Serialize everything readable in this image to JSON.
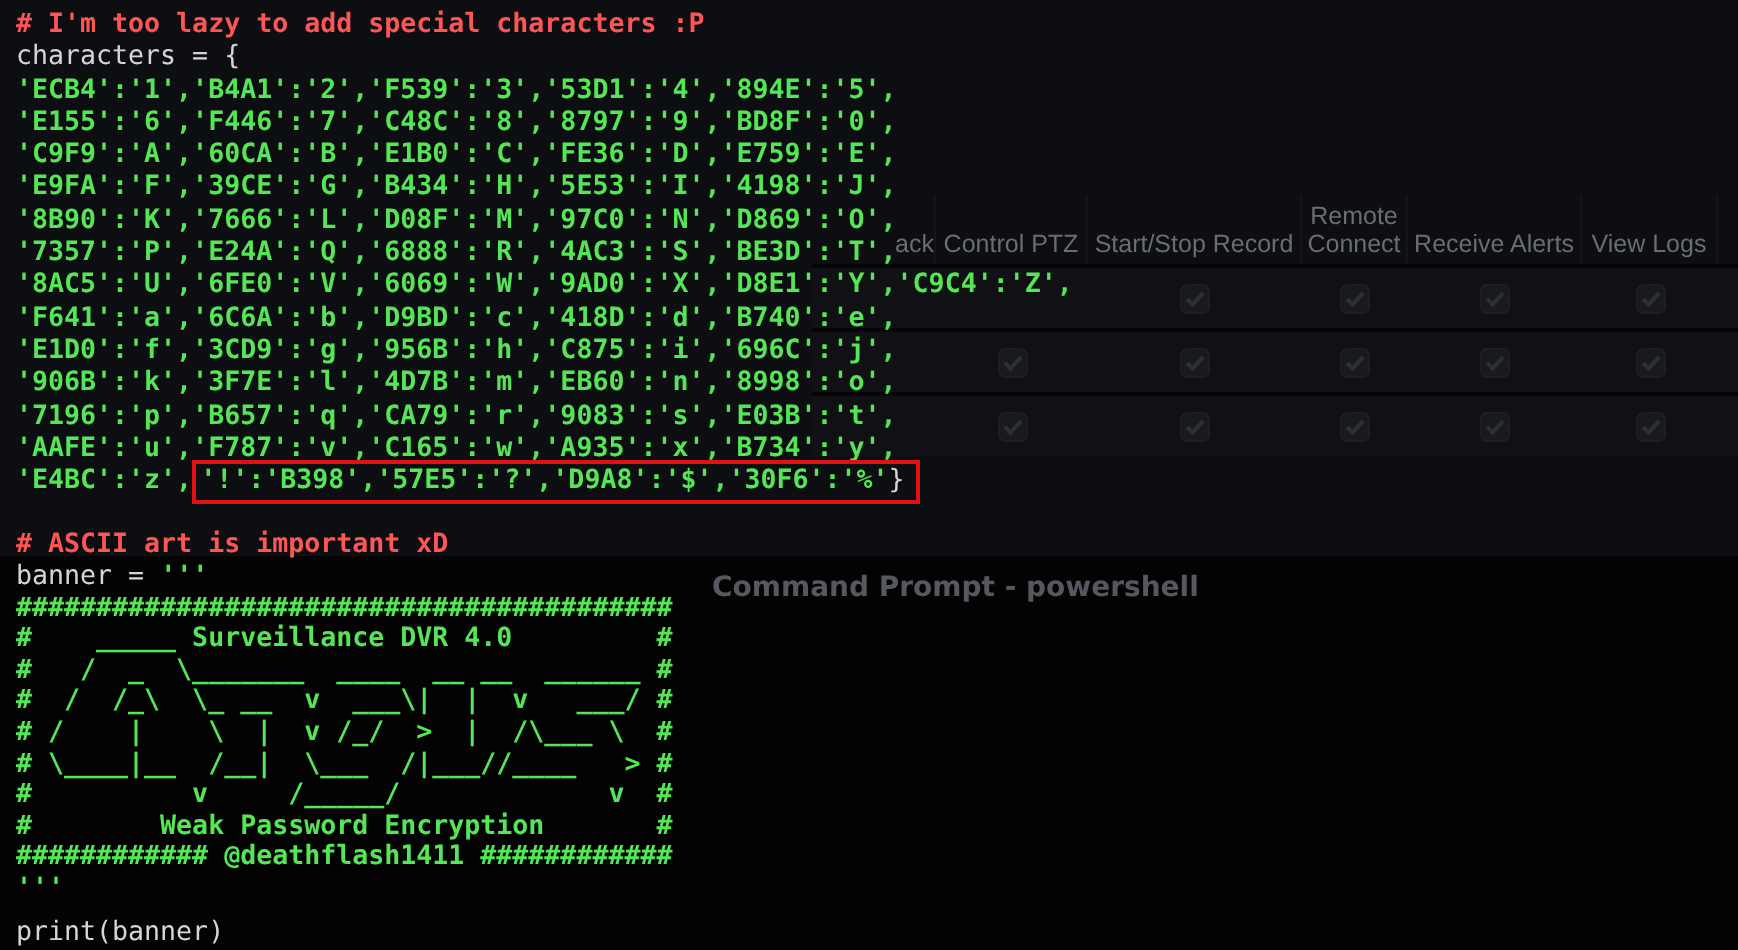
{
  "code_top": [
    {
      "segments": [
        {
          "kind": "comment",
          "text": "# I'm too lazy to add special characters :P",
          "boxed": false
        }
      ]
    },
    {
      "segments": [
        {
          "kind": "plain",
          "text": "characters = {",
          "boxed": false
        }
      ]
    },
    {
      "segments": [
        {
          "kind": "string",
          "text": "'ECB4':'1','B4A1':'2','F539':'3','53D1':'4','894E':'5',",
          "boxed": false
        }
      ]
    },
    {
      "segments": [
        {
          "kind": "string",
          "text": "'E155':'6','F446':'7','C48C':'8','8797':'9','BD8F':'0',",
          "boxed": false
        }
      ]
    },
    {
      "segments": [
        {
          "kind": "string",
          "text": "'C9F9':'A','60CA':'B','E1B0':'C','FE36':'D','E759':'E',",
          "boxed": false
        }
      ]
    },
    {
      "segments": [
        {
          "kind": "string",
          "text": "'E9FA':'F','39CE':'G','B434':'H','5E53':'I','4198':'J',",
          "boxed": false
        }
      ]
    },
    {
      "segments": [
        {
          "kind": "string",
          "text": "'8B90':'K','7666':'L','D08F':'M','97C0':'N','D869':'O',",
          "boxed": false
        }
      ]
    },
    {
      "segments": [
        {
          "kind": "string",
          "text": "'7357':'P','E24A':'Q','6888':'R','4AC3':'S','BE3D':'T',",
          "boxed": false
        }
      ]
    },
    {
      "segments": [
        {
          "kind": "string",
          "text": "'8AC5':'U','6FE0':'V','6069':'W','9AD0':'X','D8E1':'Y','C9C4':'Z',",
          "boxed": false
        }
      ]
    },
    {
      "segments": [
        {
          "kind": "string",
          "text": "'F641':'a','6C6A':'b','D9BD':'c','418D':'d','B740':'e',",
          "boxed": false
        }
      ]
    },
    {
      "segments": [
        {
          "kind": "string",
          "text": "'E1D0':'f','3CD9':'g','956B':'h','C875':'i','696C':'j',",
          "boxed": false
        }
      ]
    },
    {
      "segments": [
        {
          "kind": "string",
          "text": "'906B':'k','3F7E':'l','4D7B':'m','EB60':'n','8998':'o',",
          "boxed": false
        }
      ]
    },
    {
      "segments": [
        {
          "kind": "string",
          "text": "'7196':'p','B657':'q','CA79':'r','9083':'s','E03B':'t',",
          "boxed": false
        }
      ]
    },
    {
      "segments": [
        {
          "kind": "string",
          "text": "'AAFE':'u','F787':'v','C165':'w','A935':'x','B734':'y',",
          "boxed": false
        }
      ]
    },
    {
      "segments": [
        {
          "kind": "string",
          "text": "'E4BC':'z',",
          "boxed": false
        },
        {
          "kind": "string",
          "text": "'!':'B398','57E5':'?','D9A8':'$','30F6':'%'",
          "boxed": true
        },
        {
          "kind": "plain",
          "text": "}",
          "boxed": true
        }
      ]
    }
  ],
  "code_bottom": [
    {
      "segments": [
        {
          "kind": "comment",
          "text": "# ASCII art is important xD"
        }
      ]
    },
    {
      "segments": [
        {
          "kind": "plain",
          "text": "banner = "
        },
        {
          "kind": "string",
          "text": "'''"
        }
      ]
    },
    {
      "segments": [
        {
          "kind": "art",
          "text": "#########################################"
        }
      ]
    },
    {
      "segments": [
        {
          "kind": "art",
          "text": "#    _____ Surveillance DVR 4.0         #"
        }
      ]
    },
    {
      "segments": [
        {
          "kind": "art",
          "text": "#   /  _  \\_______  ____  __ __  ______ #"
        }
      ]
    },
    {
      "segments": [
        {
          "kind": "art",
          "text": "#  /  /_\\  \\_ __  v  ___\\|  |  v   ___/ #"
        }
      ]
    },
    {
      "segments": [
        {
          "kind": "art",
          "text": "# /    |    \\  |  v /_/  >  |  /\\___ \\  #"
        }
      ]
    },
    {
      "segments": [
        {
          "kind": "art",
          "text": "# \\____|__  /__|  \\___  /|___//____   > #"
        }
      ]
    },
    {
      "segments": [
        {
          "kind": "art",
          "text": "#          v     /_____/             v  #"
        }
      ]
    },
    {
      "segments": [
        {
          "kind": "art",
          "text": "#        Weak Password Encryption       #"
        }
      ]
    },
    {
      "segments": [
        {
          "kind": "art",
          "text": "############ @deathflash1411 ############"
        }
      ]
    },
    {
      "segments": [
        {
          "kind": "string",
          "text": "'''"
        }
      ]
    }
  ],
  "code_last": [
    {
      "segments": [
        {
          "kind": "plain",
          "text": "print(banner)"
        }
      ]
    }
  ],
  "table": {
    "columns": [
      "ack",
      "Control  PTZ",
      "Start/Stop Record",
      "Remote Connect",
      "Receive Alerts",
      "View Logs"
    ],
    "rows": [
      {
        "checks": [
          {
            "checked": true
          },
          {
            "checked": true
          },
          {
            "checked": true
          },
          {
            "checked": true
          }
        ]
      },
      {
        "checks": [
          {
            "checked": true
          },
          {
            "checked": true
          },
          {
            "checked": true
          },
          {
            "checked": true
          },
          {
            "checked": true
          }
        ]
      },
      {
        "checks": [
          {
            "checked": true
          },
          {
            "checked": true
          },
          {
            "checked": true
          },
          {
            "checked": true
          },
          {
            "checked": true
          }
        ]
      }
    ]
  },
  "window_title": "Command Prompt - powershell"
}
